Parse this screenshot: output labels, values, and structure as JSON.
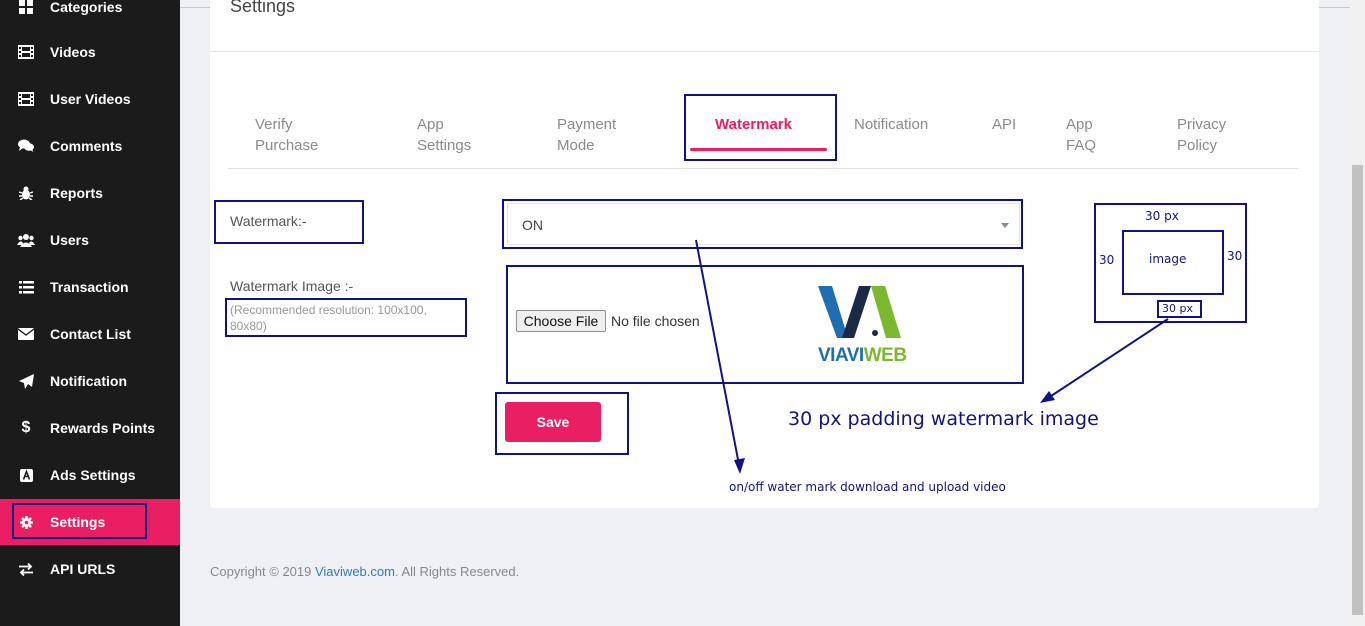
{
  "sidebar": {
    "items": [
      {
        "label": "Categories",
        "icon": "grid-icon"
      },
      {
        "label": "Videos",
        "icon": "film-icon"
      },
      {
        "label": "User Videos",
        "icon": "film-icon"
      },
      {
        "label": "Comments",
        "icon": "comments-icon"
      },
      {
        "label": "Reports",
        "icon": "bug-icon"
      },
      {
        "label": "Users",
        "icon": "users-icon"
      },
      {
        "label": "Transaction",
        "icon": "list-icon"
      },
      {
        "label": "Contact List",
        "icon": "envelope-icon"
      },
      {
        "label": "Notification",
        "icon": "paper-plane-icon"
      },
      {
        "label": "Rewards Points",
        "icon": "dollar-icon"
      },
      {
        "label": "Ads Settings",
        "icon": "ads-icon"
      },
      {
        "label": "Settings",
        "icon": "gear-icon",
        "active": true
      },
      {
        "label": "API URLS",
        "icon": "exchange-icon"
      }
    ]
  },
  "page": {
    "title": "Settings"
  },
  "tabs": [
    {
      "line1": "Verify",
      "line2": "Purchase"
    },
    {
      "line1": "App",
      "line2": "Settings"
    },
    {
      "line1": "Payment",
      "line2": "Mode"
    },
    {
      "line1": "Watermark",
      "line2": "",
      "active": true
    },
    {
      "line1": "Notification",
      "line2": ""
    },
    {
      "line1": "API",
      "line2": ""
    },
    {
      "line1": "App",
      "line2": "FAQ"
    },
    {
      "line1": "Privacy",
      "line2": "Policy"
    }
  ],
  "form": {
    "watermark_label": "Watermark:-",
    "watermark_value": "ON",
    "image_label": "Watermark Image :-",
    "image_hint_line1": "(Recommended resolution: 100x100,",
    "image_hint_line2": "80x80)",
    "choose_file_label": "Choose File",
    "file_status": "No file chosen",
    "save_label": "Save"
  },
  "logo": {
    "text_part1": "VIAVI",
    "text_part2": "WEB",
    "colors": {
      "blue": "#1f6fb0",
      "green": "#7cb82f",
      "dark": "#1b2a44"
    }
  },
  "footer": {
    "prefix": "Copyright © 2019 ",
    "link": "Viaviweb.com",
    "suffix": ". All Rights Reserved."
  },
  "annotations": {
    "padding_top": "30 px",
    "padding_left": "30",
    "padding_right": "30",
    "padding_bottom": "30 px",
    "image_label": "image",
    "padding_note": "30 px padding watermark image",
    "toggle_note": "on/off water mark download and upload video"
  },
  "colors": {
    "accent": "#e91e63",
    "sidebar_bg": "#1b1b1b",
    "annotation": "#13137f"
  }
}
